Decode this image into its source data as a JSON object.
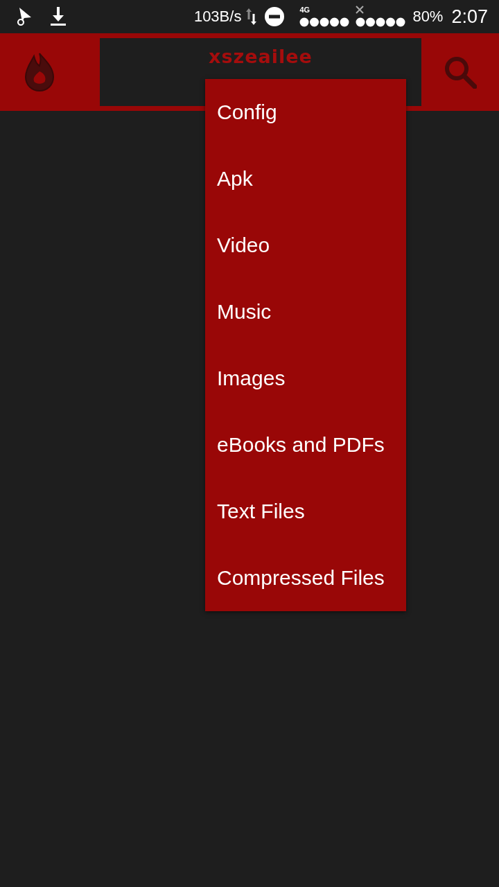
{
  "status_bar": {
    "network_speed": "103B/s",
    "network_type": "4G",
    "battery": "80%",
    "time": "2:07"
  },
  "app_bar": {
    "title": "xszeailee"
  },
  "menu": {
    "items": [
      {
        "label": "Config"
      },
      {
        "label": "Apk"
      },
      {
        "label": "Video"
      },
      {
        "label": "Music"
      },
      {
        "label": "Images"
      },
      {
        "label": "eBooks and PDFs"
      },
      {
        "label": "Text Files"
      },
      {
        "label": "Compressed Files"
      }
    ]
  }
}
